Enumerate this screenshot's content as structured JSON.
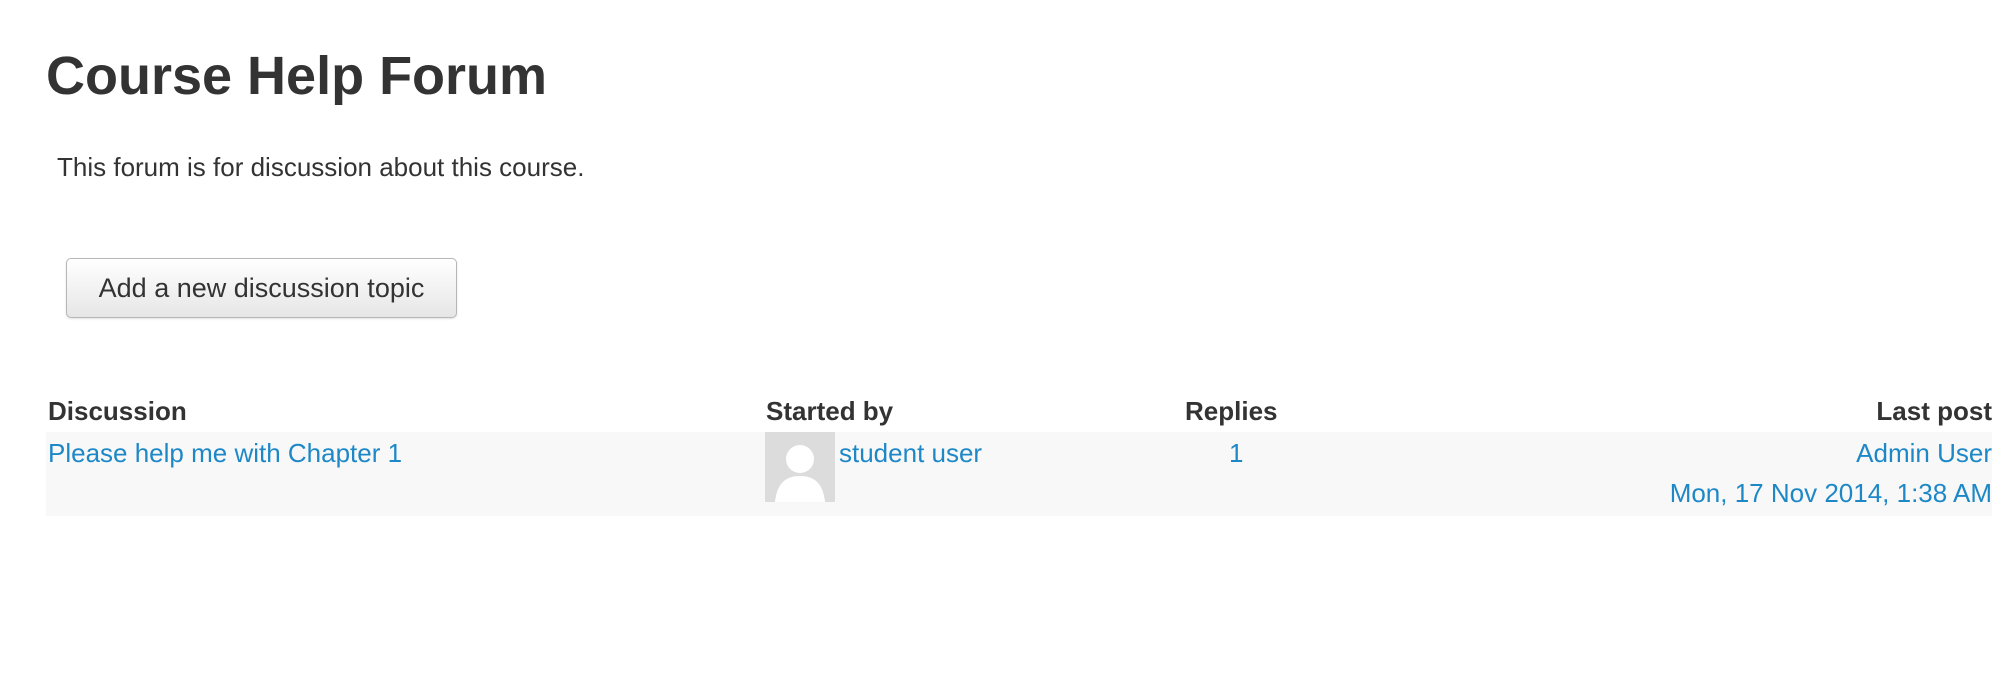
{
  "forum": {
    "title": "Course Help Forum",
    "intro": "This forum is for discussion about this course."
  },
  "actions": {
    "new_topic_label": "Add a new discussion topic"
  },
  "table": {
    "headers": {
      "discussion": "Discussion",
      "started_by": "Started by",
      "replies": "Replies",
      "last_post": "Last post"
    },
    "rows": [
      {
        "topic": "Please help me with Chapter 1",
        "author": "student user",
        "author_avatar_icon": "default-user-avatar-icon",
        "replies": "1",
        "last_post_author": "Admin User",
        "last_post_date": "Mon, 17 Nov 2014, 1:38 AM"
      }
    ]
  },
  "colors": {
    "link": "#1e88c7",
    "text": "#333333",
    "row_background": "#f8f8f8",
    "avatar_background": "#dcdcdc"
  }
}
